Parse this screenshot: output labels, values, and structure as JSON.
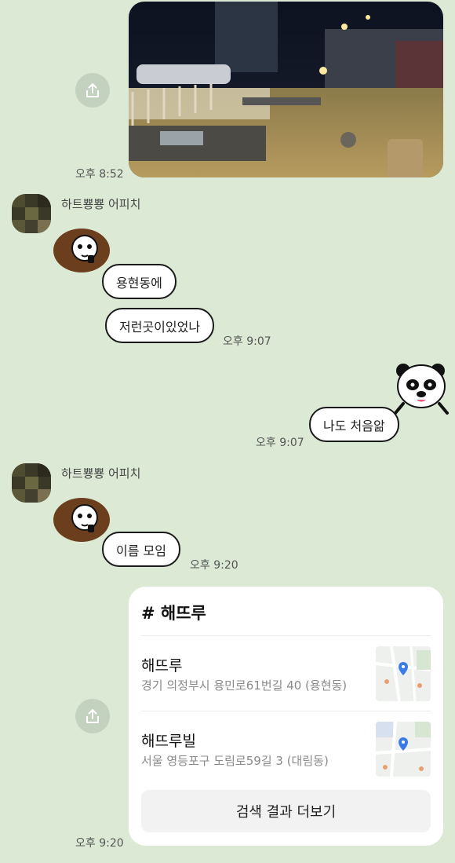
{
  "messages": {
    "m1_time": "오후 8:52",
    "sender1": "하트뿅뿅 어피치",
    "bubble_1": "용현동에",
    "bubble_2": "저런곳이있었나",
    "m2_time": "오후 9:07",
    "bubble_3": "나도 처음앎",
    "m3_time": "오후 9:07",
    "sender2": "하트뿅뿅 어피치",
    "bubble_4": "이름 모임",
    "m4_time": "오후 9:20",
    "m5_time": "오후 9:20"
  },
  "search_card": {
    "title": "# 해뜨루",
    "results": [
      {
        "name": "해뜨루",
        "address": "경기 의정부시 용민로61번길 40 (용현동)"
      },
      {
        "name": "해뜨루빌",
        "address": "서울 영등포구 도림로59길 3 (대림동)"
      }
    ],
    "more_label": "검색 결과 더보기"
  },
  "colors": {
    "background": "#dbe9d5",
    "bubble": "#ffffff",
    "share_button": "#c3d1bf"
  },
  "icons": [
    "share-icon",
    "pin-icon"
  ]
}
